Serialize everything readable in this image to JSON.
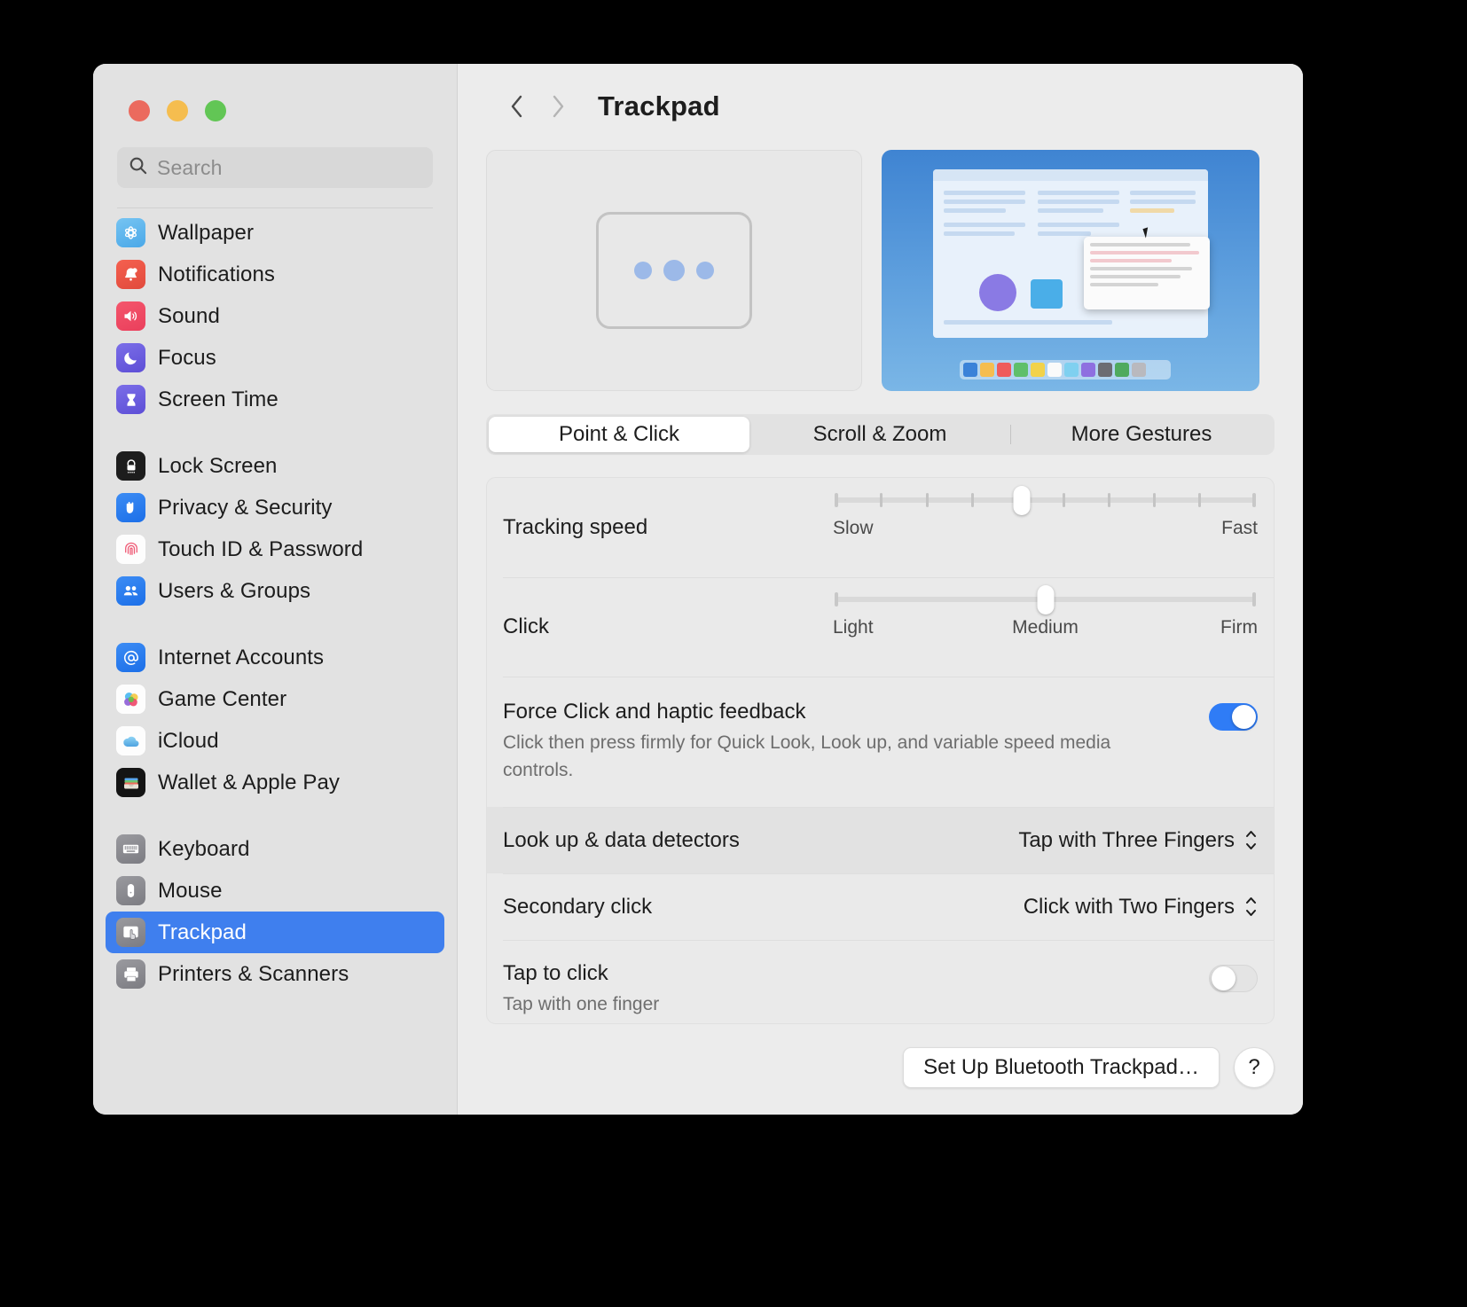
{
  "window": {
    "traffic_lights": [
      "close",
      "minimize",
      "maximize"
    ],
    "colors": {
      "close": "#eb6a5e",
      "minimize": "#f5bd4f",
      "maximize": "#62c655",
      "accent": "#3f7fee",
      "toggle_on": "#2f7cf6"
    }
  },
  "search": {
    "placeholder": "Search",
    "value": ""
  },
  "sidebar": {
    "groups": [
      {
        "items": [
          {
            "label": "Wallpaper",
            "icon": "wallpaper-icon",
            "selected": false
          },
          {
            "label": "Notifications",
            "icon": "notifications-icon",
            "selected": false
          },
          {
            "label": "Sound",
            "icon": "sound-icon",
            "selected": false
          },
          {
            "label": "Focus",
            "icon": "focus-icon",
            "selected": false
          },
          {
            "label": "Screen Time",
            "icon": "screen-time-icon",
            "selected": false
          }
        ]
      },
      {
        "items": [
          {
            "label": "Lock Screen",
            "icon": "lock-screen-icon",
            "selected": false
          },
          {
            "label": "Privacy & Security",
            "icon": "privacy-icon",
            "selected": false
          },
          {
            "label": "Touch ID & Password",
            "icon": "touch-id-icon",
            "selected": false
          },
          {
            "label": "Users & Groups",
            "icon": "users-groups-icon",
            "selected": false
          }
        ]
      },
      {
        "items": [
          {
            "label": "Internet Accounts",
            "icon": "internet-accounts-icon",
            "selected": false
          },
          {
            "label": "Game Center",
            "icon": "game-center-icon",
            "selected": false
          },
          {
            "label": "iCloud",
            "icon": "icloud-icon",
            "selected": false
          },
          {
            "label": "Wallet & Apple Pay",
            "icon": "wallet-icon",
            "selected": false
          }
        ]
      },
      {
        "items": [
          {
            "label": "Keyboard",
            "icon": "keyboard-icon",
            "selected": false
          },
          {
            "label": "Mouse",
            "icon": "mouse-icon",
            "selected": false
          },
          {
            "label": "Trackpad",
            "icon": "trackpad-icon",
            "selected": true
          },
          {
            "label": "Printers & Scanners",
            "icon": "printers-icon",
            "selected": false
          }
        ]
      }
    ]
  },
  "header": {
    "back_icon": "chevron-left-icon",
    "forward_icon": "chevron-right-icon",
    "title": "Trackpad"
  },
  "previews": {
    "left": {
      "name": "trackpad-gesture-preview",
      "dots": 3
    },
    "right": {
      "name": "desktop-gesture-preview"
    }
  },
  "tabs": [
    {
      "label": "Point & Click",
      "active": true
    },
    {
      "label": "Scroll & Zoom",
      "active": false
    },
    {
      "label": "More Gestures",
      "active": false
    }
  ],
  "settings": {
    "tracking_speed": {
      "label": "Tracking speed",
      "min_label": "Slow",
      "max_label": "Fast",
      "ticks": 10,
      "value": 5
    },
    "click": {
      "label": "Click",
      "min_label": "Light",
      "mid_label": "Medium",
      "max_label": "Firm",
      "value": 50
    },
    "force_click": {
      "label": "Force Click and haptic feedback",
      "description": "Click then press firmly for Quick Look, Look up, and variable speed media controls.",
      "enabled": true,
      "state_text": "on"
    },
    "look_up": {
      "label": "Look up & data detectors",
      "value": "Tap with Three Fingers",
      "highlighted": true
    },
    "secondary_click": {
      "label": "Secondary click",
      "value": "Click with Two Fingers",
      "highlighted": false
    },
    "tap_to_click": {
      "label": "Tap to click",
      "description": "Tap with one finger",
      "enabled": false,
      "state_text": "off"
    }
  },
  "footer": {
    "setup_button": "Set Up Bluetooth Trackpad…",
    "help_button": "?"
  }
}
